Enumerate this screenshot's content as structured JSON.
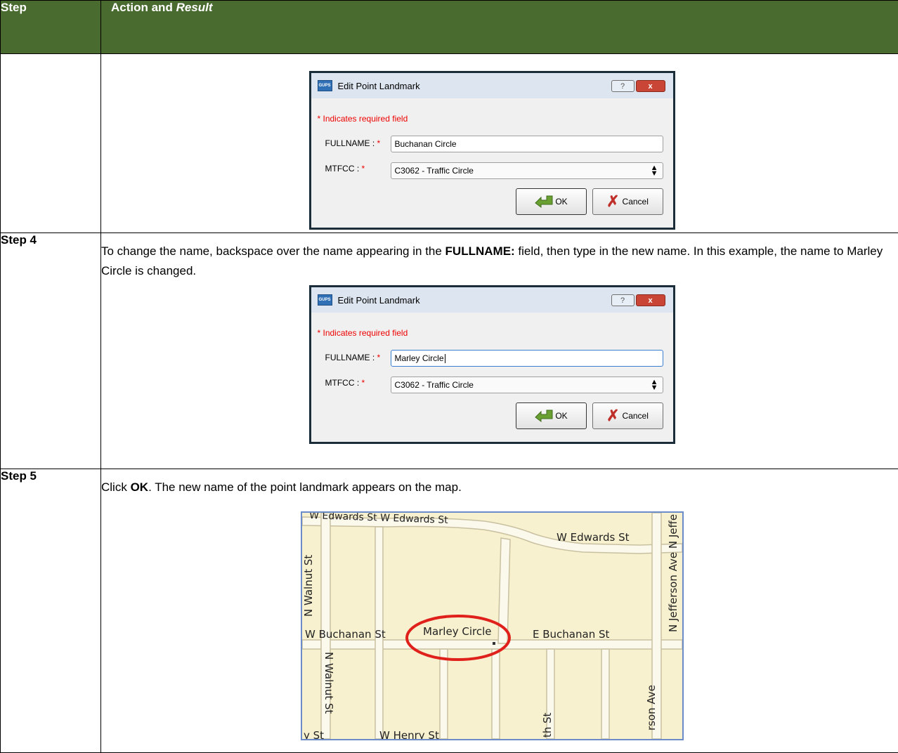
{
  "header": {
    "col1": "Step",
    "col2_plain": "Action and ",
    "col2_italic": "Result"
  },
  "dialog1": {
    "title": "Edit Point Landmark",
    "app_icon_text": "GUPS",
    "help_button": "?",
    "close_button": "x",
    "required_note": "* Indicates required field",
    "fullname_label": "FULLNAME :",
    "fullname_value": "Buchanan Circle",
    "mtfcc_label": "MTFCC :",
    "mtfcc_value": "C3062 - Traffic Circle",
    "required_star": "*",
    "ok_label": "OK",
    "cancel_label": "Cancel"
  },
  "step4": {
    "label": "Step 4",
    "text_a": "To change the name, backspace over the name appearing in the ",
    "text_bold": "FULLNAME:",
    "text_b": " field, then type in the new name. In this example, the name to Marley Circle is changed."
  },
  "dialog2": {
    "title": "Edit Point Landmark",
    "app_icon_text": "GUPS",
    "help_button": "?",
    "close_button": "x",
    "required_note": "* Indicates required field",
    "fullname_label": "FULLNAME :",
    "fullname_value": "Marley Circle",
    "mtfcc_label": "MTFCC :",
    "mtfcc_value": "C3062 - Traffic Circle",
    "required_star": "*",
    "ok_label": "OK",
    "cancel_label": "Cancel"
  },
  "step5": {
    "label": "Step 5",
    "text_a": "Click ",
    "text_bold": "OK",
    "text_b": ". The new name of the point landmark appears on the map."
  },
  "map": {
    "labels": {
      "w_edwards_top_left": "W Edwards St W Edwards St",
      "w_edwards_right": "W Edwards St",
      "n_walnut_top": "N Walnut St",
      "n_jefferson": "N Jefferson Ave N Jeffe",
      "w_buchanan": "W Buchanan St",
      "marley_circle": "Marley Circle",
      "e_buchanan": "E Buchanan St",
      "n_walnut_bottom": "N Walnut St",
      "w_henry": "W Henry St",
      "y_st": "y St",
      "th_st": "th St",
      "rson_ave": "rson Ave"
    },
    "colors": {
      "background": "#f7f1cf",
      "road": "#fbf8ec",
      "road_edge": "#c9c0a0",
      "highlight": "#e0201b",
      "border": "#6b8cc9"
    }
  }
}
